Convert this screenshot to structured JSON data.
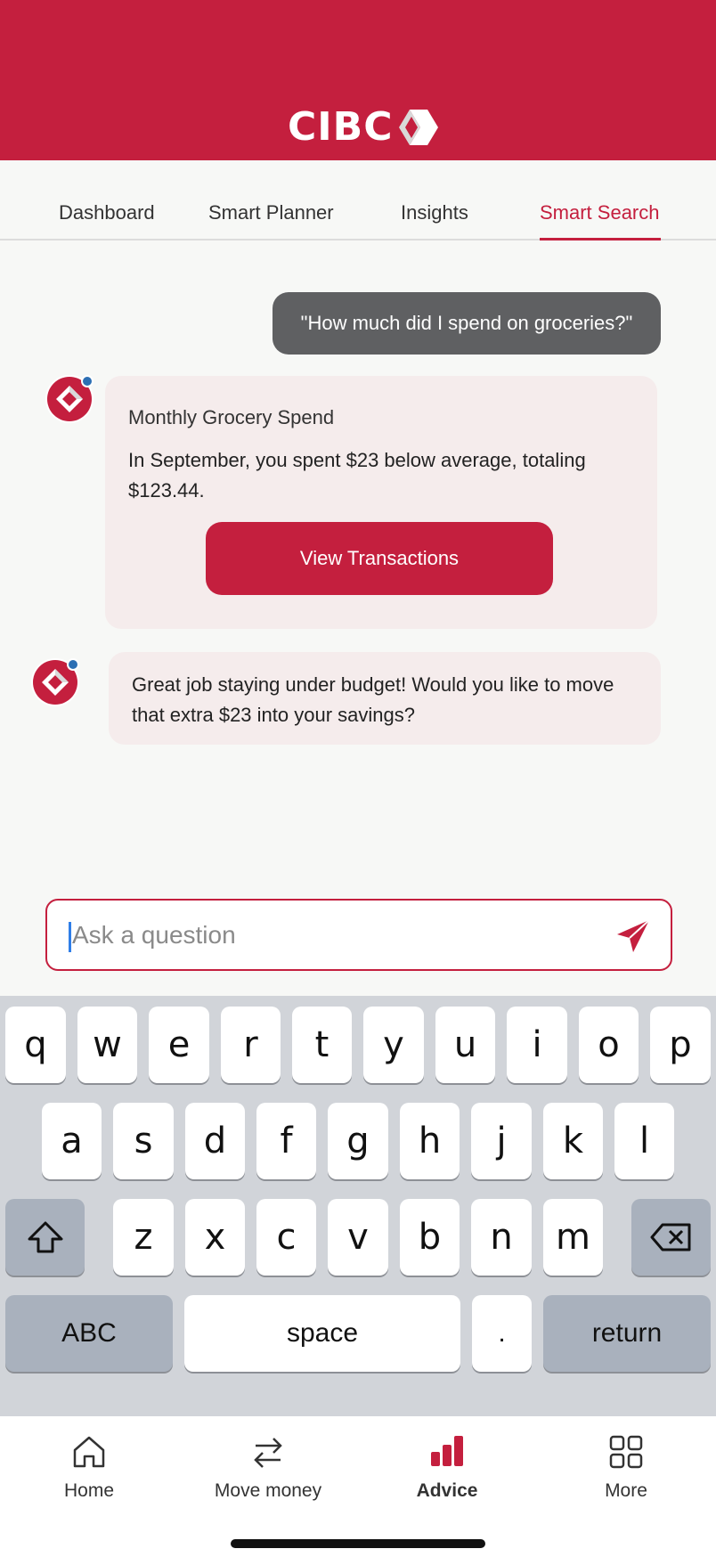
{
  "colors": {
    "brand": "#c41f3e",
    "user_bubble": "#5f6062",
    "bot_bubble": "#f5ecec",
    "status_dot": "#2c6fb3"
  },
  "header": {
    "logo_text": "CIBC",
    "logo_icon": "cibc-diamond-icon"
  },
  "tabs": [
    {
      "label": "Dashboard",
      "active": false
    },
    {
      "label": "Smart Planner",
      "active": false
    },
    {
      "label": "Insights",
      "active": false
    },
    {
      "label": "Smart Search",
      "active": true
    }
  ],
  "chat": {
    "user_message": "\"How much did I spend on groceries?\"",
    "bot_card": {
      "title": "Monthly Grocery Spend",
      "body": "In September, you spent $23 below average, totaling $123.44.",
      "button_label": "View Transactions"
    },
    "bot_message": "Great job staying under budget! Would you like to move that extra $23 into your savings?"
  },
  "input": {
    "placeholder": "Ask a question",
    "value": "",
    "send_icon": "send-icon"
  },
  "keyboard": {
    "row1": [
      "q",
      "w",
      "e",
      "r",
      "t",
      "y",
      "u",
      "i",
      "o",
      "p"
    ],
    "row2": [
      "a",
      "s",
      "d",
      "f",
      "g",
      "h",
      "j",
      "k",
      "l"
    ],
    "row3": [
      "z",
      "x",
      "c",
      "v",
      "b",
      "n",
      "m"
    ],
    "shift_icon": "shift-icon",
    "delete_icon": "delete-icon",
    "abc_label": "ABC",
    "space_label": "space",
    "period_label": ".",
    "return_label": "return"
  },
  "bottom_nav": [
    {
      "label": "Home",
      "icon": "home-icon",
      "active": false
    },
    {
      "label": "Move money",
      "icon": "transfer-icon",
      "active": false
    },
    {
      "label": "Advice",
      "icon": "bar-chart-icon",
      "active": true
    },
    {
      "label": "More",
      "icon": "grid-icon",
      "active": false
    }
  ]
}
